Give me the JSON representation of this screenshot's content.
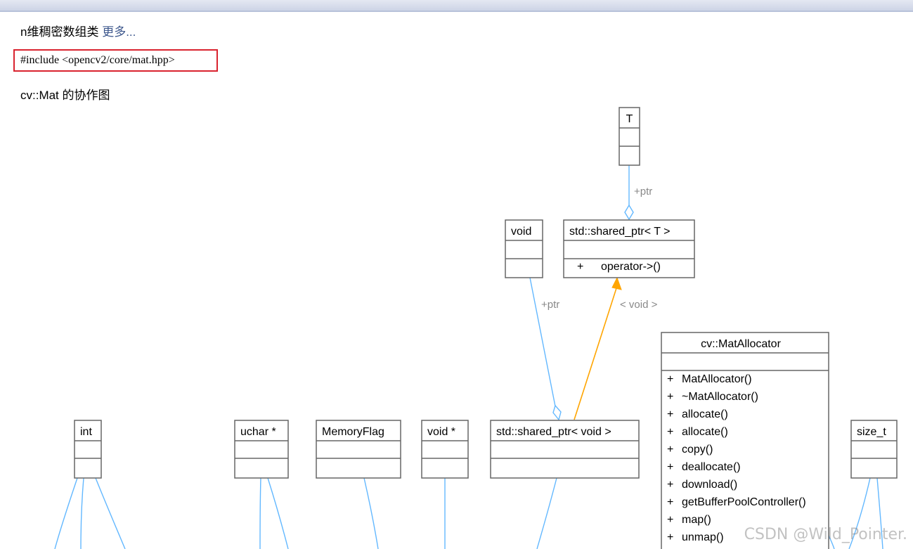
{
  "header": {
    "summary_text": "n维稠密数组类",
    "more_link": "更多..."
  },
  "include_line": "#include <opencv2/core/mat.hpp>",
  "collab_title": "cv::Mat 的协作图",
  "diagram": {
    "nodes": {
      "T": {
        "name": "T"
      },
      "void": {
        "name": "void"
      },
      "shared_ptr_T": {
        "name": "std::shared_ptr< T >",
        "methods": [
          "operator->()"
        ]
      },
      "mat_allocator": {
        "name": "cv::MatAllocator",
        "methods": [
          "MatAllocator()",
          "~MatAllocator()",
          "allocate()",
          "allocate()",
          "copy()",
          "deallocate()",
          "download()",
          "getBufferPoolController()",
          "map()",
          "unmap()"
        ]
      },
      "int": {
        "name": "int"
      },
      "uchar_ptr": {
        "name": "uchar *"
      },
      "memory_flag": {
        "name": "MemoryFlag"
      },
      "void_ptr": {
        "name": "void *"
      },
      "shared_ptr_void": {
        "name": "std::shared_ptr< void >"
      },
      "size_t": {
        "name": "size_t"
      }
    },
    "edge_labels": {
      "t_to_shared_ptr": "+ptr",
      "void_to_shared_ptr_void": "+ptr",
      "template_instantiation": "< void >"
    },
    "member_marker": "+",
    "colors": {
      "member_edge": "#63b8ff",
      "template_edge": "#ffa500",
      "box_border": "#666666",
      "more_link": "#3d578c"
    }
  },
  "watermark": "CSDN @Wild_Pointer."
}
